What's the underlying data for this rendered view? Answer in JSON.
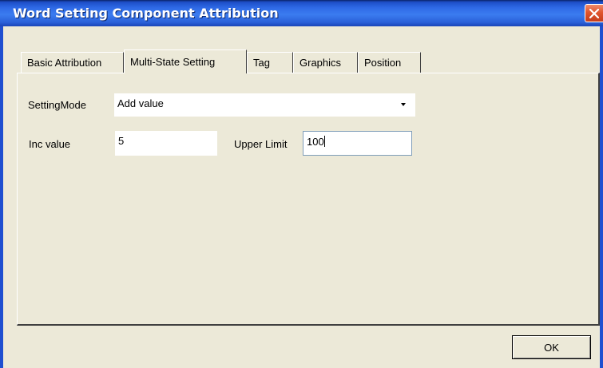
{
  "window": {
    "title": "Word Setting Component Attribution"
  },
  "tabs": [
    {
      "label": "Basic Attribution",
      "active": false
    },
    {
      "label": "Multi-State Setting",
      "active": true
    },
    {
      "label": "Tag",
      "active": false
    },
    {
      "label": "Graphics",
      "active": false
    },
    {
      "label": "Position",
      "active": false
    }
  ],
  "form": {
    "setting_mode": {
      "label": "SettingMode",
      "value": "Add value"
    },
    "inc_value": {
      "label": "Inc value",
      "value": "5"
    },
    "upper_limit": {
      "label": "Upper Limit",
      "value": "100"
    }
  },
  "footer": {
    "ok_label": "OK"
  },
  "colors": {
    "titlebar": "#2f6ae6",
    "close_button": "#e0552e",
    "dialog_background": "#ece9d8"
  }
}
